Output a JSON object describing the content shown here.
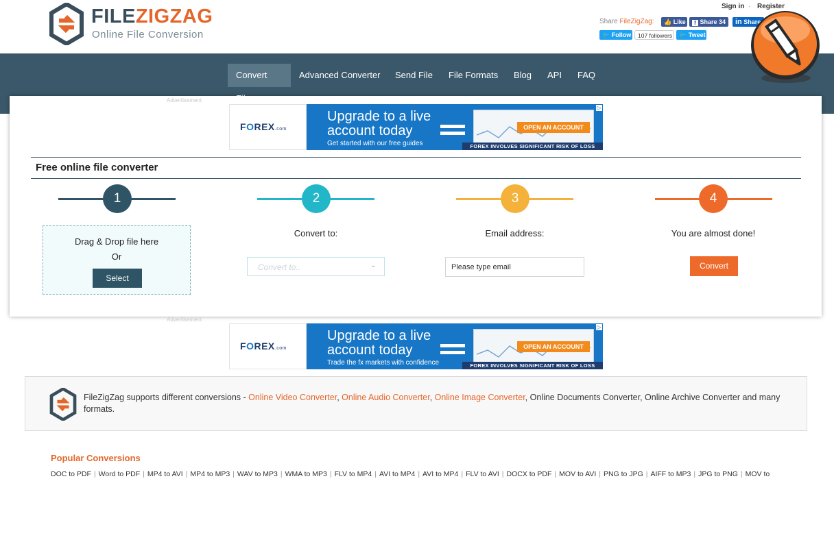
{
  "header": {
    "logo_part1": "FILE",
    "logo_part2": "ZIGZAG",
    "logo_subtitle": "Online File Conversion",
    "sign_in": "Sign in",
    "dot": "·",
    "register": "Register",
    "share_prefix": "Share ",
    "share_brand": "FileZigZag:",
    "like_label": "Like",
    "fb_share_label": "Share 34",
    "li_share_label": "Share",
    "follow_label": "Follow",
    "followers_label": "107 followers",
    "tweet_label": "Tweet"
  },
  "nav": {
    "items": [
      {
        "label": "Convert File"
      },
      {
        "label": "Advanced Converter"
      },
      {
        "label": "Send File"
      },
      {
        "label": "File Formats"
      },
      {
        "label": "Blog"
      },
      {
        "label": "API"
      },
      {
        "label": "FAQ"
      }
    ]
  },
  "ads": [
    {
      "label": "Advertisement",
      "brand": "F",
      "brand_o": "O",
      "brand_rest": "REX",
      "brand_suffix": ".com",
      "headline": "Upgrade to a live account today",
      "sub": "Get started with our free guides",
      "cta": "OPEN AN ACCOUNT",
      "risk": "FOREX INVOLVES SIGNIFICANT RISK OF LOSS"
    },
    {
      "label": "Advertisement",
      "brand": "F",
      "brand_o": "O",
      "brand_rest": "REX",
      "brand_suffix": ".com",
      "headline": "Upgrade to a live account today",
      "sub": "Trade the fx markets with confidence",
      "cta": "OPEN AN ACCOUNT",
      "risk": "FOREX INVOLVES SIGNIFICANT RISK OF LOSS"
    }
  ],
  "converter": {
    "title": "Free online file converter",
    "steps": [
      {
        "number": "1",
        "color": "#2f5466"
      },
      {
        "number": "2",
        "label": "Convert to:",
        "color": "#21b6c8"
      },
      {
        "number": "3",
        "label": "Email address:",
        "color": "#f4b23a"
      },
      {
        "number": "4",
        "label": "You are almost done!",
        "color": "#ee6a2a"
      }
    ],
    "drop_line1": "Drag & Drop file here",
    "drop_line2": "Or",
    "select_label": "Select",
    "convert_to_placeholder": "Convert to..",
    "email_placeholder": "Please type email",
    "convert_label": "Convert"
  },
  "info": {
    "prefix": "FileZigZag supports different conversions - ",
    "link1": "Online Video Converter",
    "comma1": ", ",
    "link2": "Online Audio Converter",
    "comma2": ", ",
    "link3": "Online Image Converter",
    "suffix": ", Online Documents Converter, Online Archive Converter and many formats."
  },
  "popular": {
    "title": "Popular Conversions",
    "separator": "|",
    "items": [
      "DOC to PDF",
      "Word to PDF",
      "MP4 to AVI",
      "MP4 to MP3",
      "WAV to MP3",
      "WMA to MP3",
      "FLV to MP4",
      "AVI to MP4",
      "AVI to MP4",
      "FLV to AVI",
      "DOCX to PDF",
      "MOV to AVI",
      "PNG to JPG",
      "AIFF to MP3",
      "JPG to PNG",
      "MOV to"
    ]
  },
  "colors": {
    "brand_orange": "#e5662a",
    "brand_dark": "#3a4d5a",
    "nav_bg": "#3a5869",
    "nav_active": "#5a7788"
  }
}
